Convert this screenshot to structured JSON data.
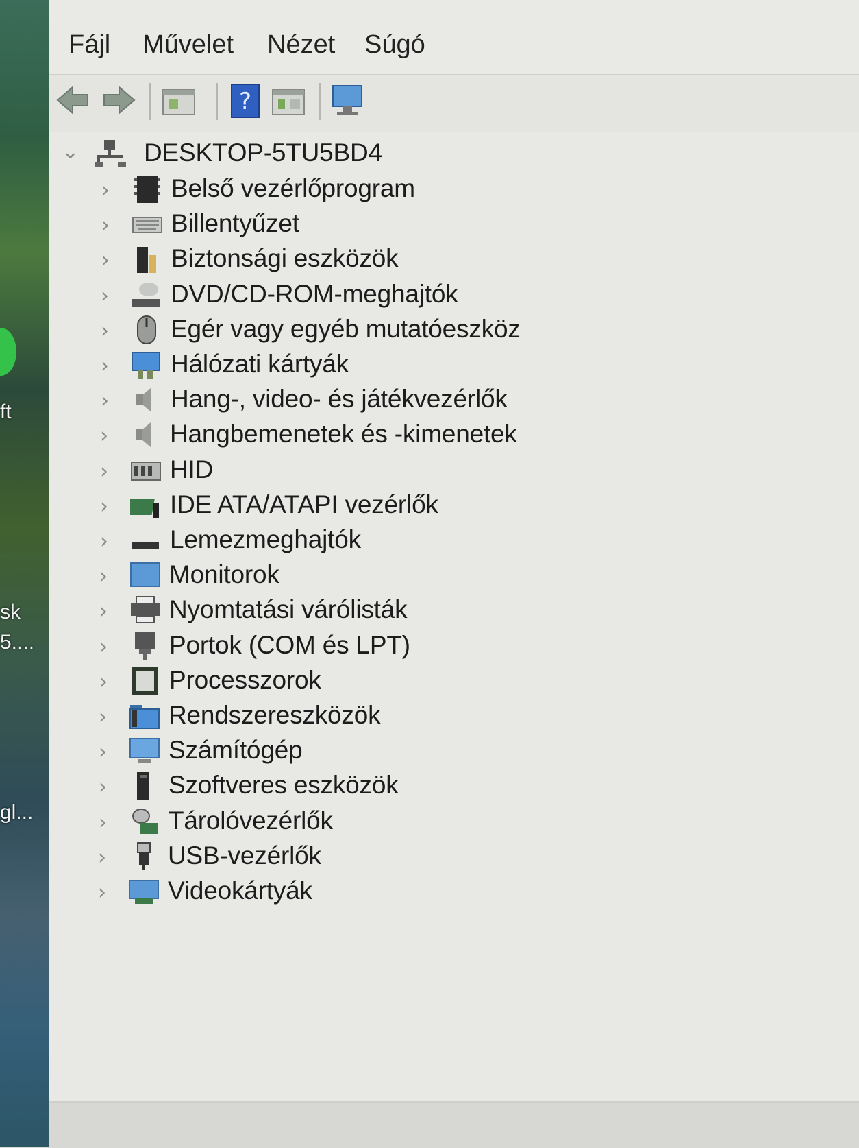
{
  "desktop": {
    "labels": [
      "ft",
      "sk",
      "5....",
      "gl..."
    ]
  },
  "menu": {
    "items": [
      "Fájl",
      "Művelet",
      "Nézet",
      "Súgó"
    ]
  },
  "toolbar": {
    "buttons": [
      "back-arrow-icon",
      "forward-arrow-icon",
      "properties-icon",
      "help-icon",
      "update-driver-icon",
      "scan-hardware-icon"
    ]
  },
  "tree": {
    "root": "DESKTOP-5TU5BD4",
    "items": [
      "Belső vezérlőprogram",
      "Billentyűzet",
      "Biztonsági eszközök",
      "DVD/CD-ROM-meghajtók",
      "Egér vagy egyéb mutatóeszköz",
      "Hálózati kártyák",
      "Hang-, video- és játékvezérlők",
      "Hangbemenetek és -kimenetek",
      "HID",
      "IDE ATA/ATAPI vezérlők",
      "Lemezmeghajtók",
      "Monitorok",
      "Nyomtatási várólisták",
      "Portok (COM és LPT)",
      "Processzorok",
      "Rendszereszközök",
      "Számítógép",
      "Szoftveres eszközök",
      "Tárolóvezérlők",
      "USB-vezérlők",
      "Videokártyák"
    ]
  },
  "colors": {
    "accent_blue": "#3a7fd0",
    "text": "#1c1c1c",
    "background": "#e8e8e5"
  }
}
